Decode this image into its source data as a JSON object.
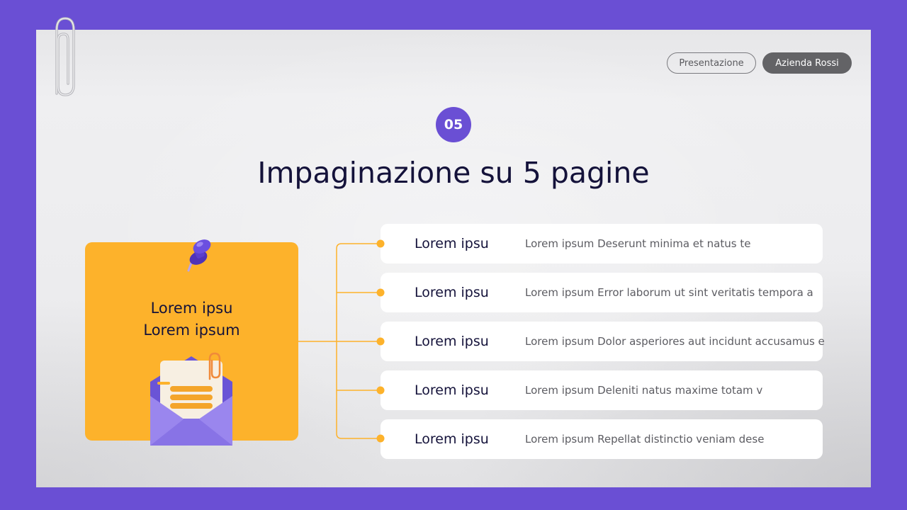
{
  "header": {
    "pill_presentation": "Presentazione",
    "pill_company": "Azienda Rossi"
  },
  "slide": {
    "number": "05",
    "title": "Impaginazione su 5 pagine"
  },
  "card": {
    "line1": "Lorem ipsu",
    "line2": "Lorem ipsum",
    "icons": [
      "pushpin-icon",
      "envelope-icon",
      "paperclip-icon"
    ]
  },
  "items": [
    {
      "title": "Lorem ipsu",
      "desc": "Lorem ipsum Deserunt minima et natus te"
    },
    {
      "title": "Lorem ipsu",
      "desc": "Lorem ipsum Error laborum ut sint veritatis tempora a"
    },
    {
      "title": "Lorem ipsu",
      "desc": "Lorem ipsum Dolor asperiores aut incidunt accusamus e"
    },
    {
      "title": "Lorem ipsu",
      "desc": "Lorem ipsum Deleniti natus maxime totam v"
    },
    {
      "title": "Lorem ipsu",
      "desc": "Lorem ipsum Repellat distinctio veniam dese"
    }
  ],
  "colors": {
    "frame": "#6a4fd4",
    "accent_orange": "#fdb22b",
    "title_text": "#14123a"
  }
}
